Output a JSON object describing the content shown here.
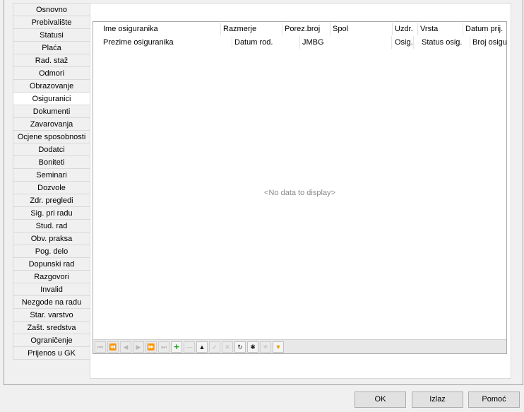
{
  "tabs": [
    {
      "label": "Osnovno",
      "active": false
    },
    {
      "label": "Prebivalište",
      "active": false
    },
    {
      "label": "Statusi",
      "active": false
    },
    {
      "label": "Plaća",
      "active": false
    },
    {
      "label": "Rad. staž",
      "active": false
    },
    {
      "label": "Odmori",
      "active": false
    },
    {
      "label": "Obrazovanje",
      "active": false
    },
    {
      "label": "Osiguranici",
      "active": true
    },
    {
      "label": "Dokumenti",
      "active": false
    },
    {
      "label": "Zavarovanja",
      "active": false
    },
    {
      "label": "Ocjene sposobnosti",
      "active": false
    },
    {
      "label": "Dodatci",
      "active": false
    },
    {
      "label": "Boniteti",
      "active": false
    },
    {
      "label": "Seminari",
      "active": false
    },
    {
      "label": "Dozvole",
      "active": false
    },
    {
      "label": "Zdr. pregledi",
      "active": false
    },
    {
      "label": "Sig. pri radu",
      "active": false
    },
    {
      "label": "Stud. rad",
      "active": false
    },
    {
      "label": "Obv. praksa",
      "active": false
    },
    {
      "label": "Pog. delo",
      "active": false
    },
    {
      "label": "Dopunski rad",
      "active": false
    },
    {
      "label": "Razgovori",
      "active": false
    },
    {
      "label": "Invalid",
      "active": false
    },
    {
      "label": "Nezgode na radu",
      "active": false
    },
    {
      "label": "Star. varstvo",
      "active": false
    },
    {
      "label": "Zašt. sredstva",
      "active": false
    },
    {
      "label": "Ograničenje",
      "active": false
    },
    {
      "label": "Prijenos u GK",
      "active": false
    }
  ],
  "grid": {
    "header_row1": [
      "Ime osiguranika",
      "Razmerje",
      "Porez.broj",
      "Spol",
      "Uzdr.",
      "Vrsta",
      "Datum prij."
    ],
    "header_row2": [
      "Prezime osiguranika",
      "Datum rod.",
      "JMBG",
      "Osig.",
      "Status osig.",
      "Broj osigu"
    ],
    "empty_text": "<No data to display>"
  },
  "navigator": [
    {
      "icon": "first-page-icon",
      "glyph": "⏮",
      "enabled": false
    },
    {
      "icon": "prev-page-icon",
      "glyph": "⏪",
      "enabled": false
    },
    {
      "icon": "prev-record-icon",
      "glyph": "◀",
      "enabled": false
    },
    {
      "icon": "next-record-icon",
      "glyph": "▶",
      "enabled": false
    },
    {
      "icon": "next-page-icon",
      "glyph": "⏩",
      "enabled": false
    },
    {
      "icon": "last-page-icon",
      "glyph": "⏭",
      "enabled": false
    },
    {
      "icon": "insert-icon",
      "glyph": "+",
      "enabled": true
    },
    {
      "icon": "delete-icon",
      "glyph": "—",
      "enabled": false
    },
    {
      "icon": "move-up-icon",
      "glyph": "▲",
      "enabled": true
    },
    {
      "icon": "edit-icon",
      "glyph": "✓",
      "enabled": false
    },
    {
      "icon": "cancel-icon",
      "glyph": "✕",
      "enabled": false
    },
    {
      "icon": "refresh-icon",
      "glyph": "↻",
      "enabled": true
    },
    {
      "icon": "asterisk-icon",
      "glyph": "✱",
      "enabled": true
    },
    {
      "icon": "star-icon",
      "glyph": "✳",
      "enabled": false
    },
    {
      "icon": "filter-icon",
      "glyph": "▼",
      "enabled": true
    }
  ],
  "buttons": {
    "ok": "OK",
    "exit": "Izlaz",
    "help": "Pomoć"
  }
}
